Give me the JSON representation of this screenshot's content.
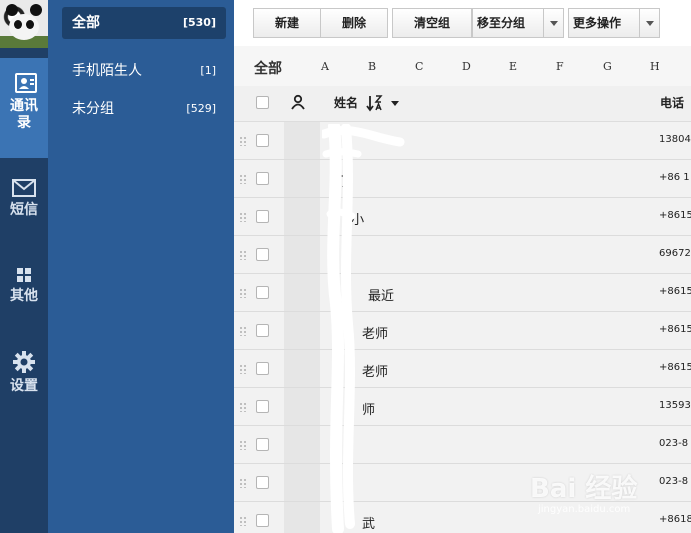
{
  "rail": {
    "contacts_label": "通讯录",
    "sms_label": "短信",
    "other_label": "其他",
    "settings_label": "设置"
  },
  "groups": [
    {
      "label": "全部",
      "count": "[530]"
    },
    {
      "label": "手机陌生人",
      "count": "[1]"
    },
    {
      "label": "未分组",
      "count": "[529]"
    }
  ],
  "toolbar": {
    "new_label": "新建",
    "delete_label": "删除",
    "clear_group_label": "清空组",
    "move_group_label": "移至分组",
    "more_label": "更多操作"
  },
  "alphabet": {
    "all_label": "全部",
    "letters": [
      "A",
      "B",
      "C",
      "D",
      "E",
      "F",
      "G",
      "H"
    ]
  },
  "table": {
    "name_header": "姓名",
    "phone_header": "电话",
    "rows": [
      {
        "name": "",
        "phone": "13804"
      },
      {
        "name": "门",
        "phone": "+86 1"
      },
      {
        "name": "门 小",
        "phone": "+8615"
      },
      {
        "name": "",
        "phone": "69672"
      },
      {
        "name": "最近",
        "phone": "+8615"
      },
      {
        "name": "老师",
        "phone": "+8615"
      },
      {
        "name": "老师",
        "phone": "+8615"
      },
      {
        "name": "师",
        "phone": "13593"
      },
      {
        "name": "",
        "phone": "023-8"
      },
      {
        "name": "",
        "phone": "023-8"
      },
      {
        "name": "武",
        "phone": "+8618"
      }
    ]
  },
  "watermark": {
    "main": "Bai 经验",
    "sub": "jingyan.baidu.com"
  },
  "colors": {
    "rail_bg": "#1f3f66",
    "rail_active": "#3b74b4",
    "groups_bg": "#2b5c96",
    "group_active": "#1d416b"
  }
}
